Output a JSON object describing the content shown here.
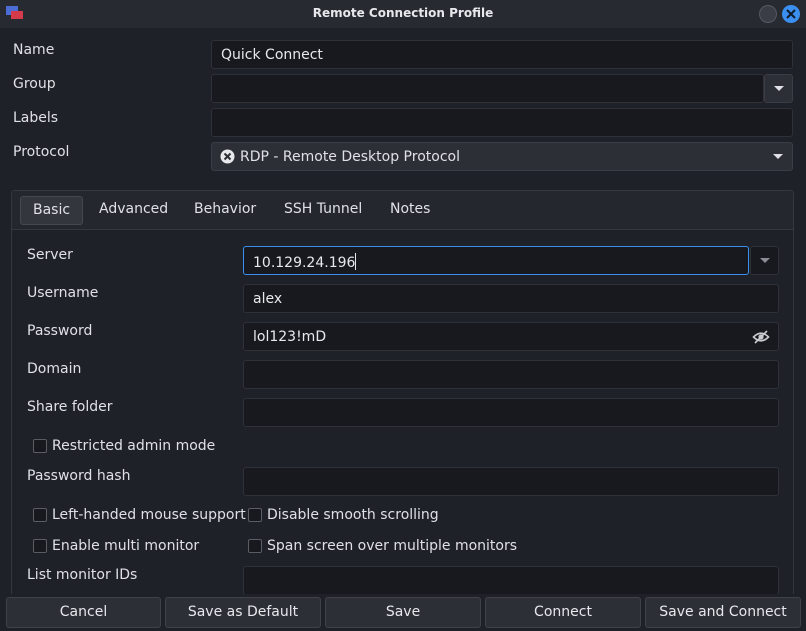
{
  "window": {
    "title": "Remote Connection Profile"
  },
  "profile": {
    "name_label": "Name",
    "name_value": "Quick Connect",
    "group_label": "Group",
    "group_value": "",
    "labels_label": "Labels",
    "labels_value": "",
    "protocol_label": "Protocol",
    "protocol_value": "RDP - Remote Desktop Protocol"
  },
  "tabs": [
    {
      "label": "Basic",
      "active": true
    },
    {
      "label": "Advanced"
    },
    {
      "label": "Behavior"
    },
    {
      "label": "SSH Tunnel"
    },
    {
      "label": "Notes"
    }
  ],
  "basic": {
    "server_label": "Server",
    "server_value": "10.129.24.196",
    "username_label": "Username",
    "username_value": "alex",
    "password_label": "Password",
    "password_value": "lol123!mD",
    "domain_label": "Domain",
    "domain_value": "",
    "share_folder_label": "Share folder",
    "share_folder_value": "",
    "restricted_admin_label": "Restricted admin mode",
    "password_hash_label": "Password hash",
    "password_hash_value": "",
    "left_handed_label": "Left-handed mouse support",
    "disable_smooth_label": "Disable smooth scrolling",
    "multi_monitor_label": "Enable multi monitor",
    "span_screen_label": "Span screen over multiple monitors",
    "list_monitor_label": "List monitor IDs",
    "list_monitor_value": ""
  },
  "buttons": {
    "cancel": "Cancel",
    "save_default": "Save as Default",
    "save": "Save",
    "connect": "Connect",
    "save_connect": "Save and Connect"
  },
  "colors": {
    "accent": "#3b8ff0",
    "background": "#1e2127",
    "field": "#17191e"
  }
}
